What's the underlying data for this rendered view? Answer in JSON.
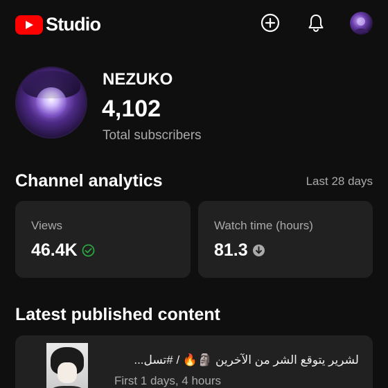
{
  "app": {
    "brand": "Studio",
    "brand_color": "#ff0000"
  },
  "topbar": {
    "icons": [
      "create-icon",
      "notifications-bell-icon",
      "account-avatar"
    ]
  },
  "channel": {
    "name": "NEZUKO",
    "subscribers": "4,102",
    "subscribers_label": "Total subscribers"
  },
  "analytics": {
    "title": "Channel analytics",
    "period": "Last 28 days",
    "cards": [
      {
        "label": "Views",
        "value": "46.4K",
        "status_icon": "check-circle-icon",
        "status_color": "#2ba640"
      },
      {
        "label": "Watch time (hours)",
        "value": "81.3",
        "status_icon": "arrow-down-circle-icon",
        "status_color": "#aaaaaa"
      }
    ]
  },
  "latest": {
    "title": "Latest published content",
    "item": {
      "title": "لشرير يتوقع الشر من الآخرين 🗿🔥 / #تسل...",
      "meta": "First 1 days, 4 hours"
    }
  },
  "colors": {
    "background": "#0f0f0f",
    "card": "#212121",
    "secondary_text": "#aaaaaa",
    "positive": "#2ba640"
  }
}
